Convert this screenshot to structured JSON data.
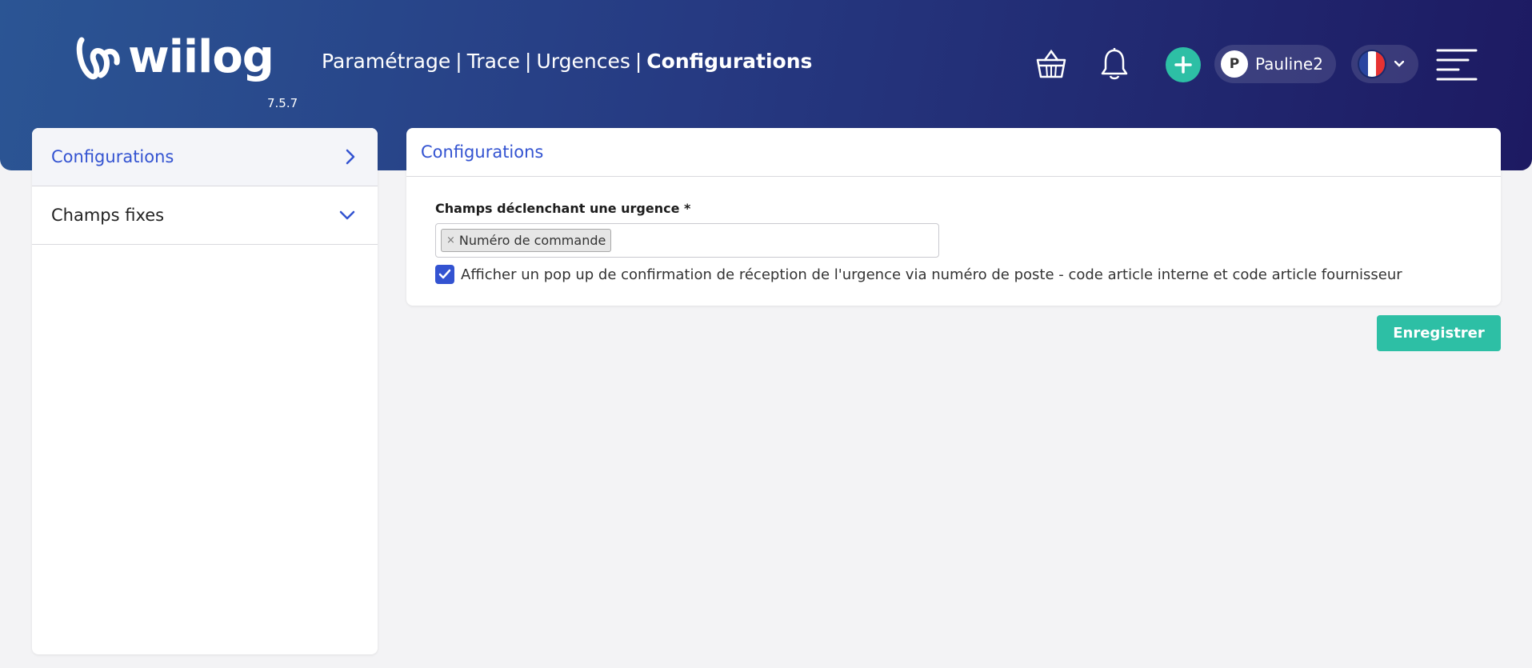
{
  "app": {
    "logo_text": "wiilog",
    "version": "7.5.7"
  },
  "breadcrumb": {
    "items": [
      "Paramétrage",
      "Trace",
      "Urgences"
    ],
    "separator": "|",
    "current": "Configurations"
  },
  "header": {
    "icons": [
      "basket-icon",
      "bell-icon",
      "plus-icon",
      "menu-icon"
    ],
    "user": {
      "initial": "P",
      "name": "Pauline2"
    },
    "language": {
      "flag": "fr",
      "flag_colors": [
        "#2a45a0",
        "#ffffff",
        "#e63232"
      ]
    }
  },
  "sidebar": {
    "items": [
      {
        "label": "Configurations",
        "active": true,
        "icon": "chevron-right-icon"
      },
      {
        "label": "Champs fixes",
        "active": false,
        "icon": "chevron-down-icon"
      }
    ]
  },
  "main": {
    "card_title": "Configurations",
    "field": {
      "label": "Champs déclenchant une urgence *",
      "selected_tags": [
        "Numéro de commande"
      ],
      "remove_symbol": "×"
    },
    "checkbox": {
      "checked": true,
      "label": "Afficher un pop up de confirmation de réception de l'urgence via numéro de poste - code article interne et code article fournisseur"
    },
    "save_label": "Enregistrer"
  },
  "colors": {
    "accent_blue": "#3353d1",
    "teal": "#2dbfa5",
    "header_start": "#2b5594",
    "header_end": "#1d1a62"
  }
}
